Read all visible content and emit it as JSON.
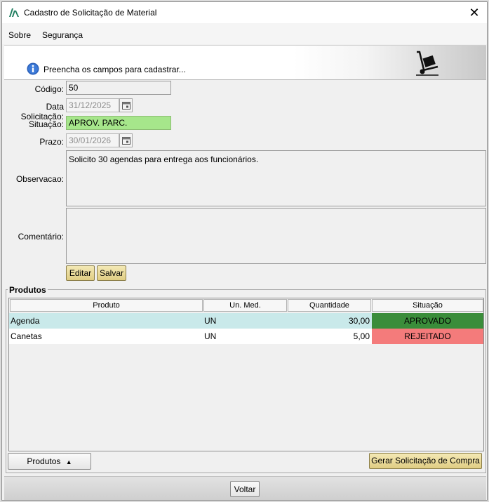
{
  "window": {
    "title": "Cadastro de Solicitação de Material"
  },
  "menu": {
    "sobre": "Sobre",
    "seguranca": "Segurança"
  },
  "banner": {
    "text": "Preencha os campos para cadastrar..."
  },
  "form": {
    "codigo_label": "Código:",
    "codigo_value": "50",
    "data_label": "Data Solicitação:",
    "data_value": "31/12/2025",
    "situacao_label": "Situação:",
    "situacao_value": "APROV. PARC.",
    "prazo_label": "Prazo:",
    "prazo_value": "30/01/2026",
    "observacao_label": "Observacao:",
    "observacao_value": "Solicito 30 agendas para entrega aos funcionários.",
    "comentario_label": "Comentário:",
    "comentario_value": ""
  },
  "buttons": {
    "editar": "Editar",
    "salvar": "Salvar",
    "produtos": "Produtos",
    "gerar": "Gerar Solicitação de Compra",
    "voltar": "Voltar"
  },
  "produtos": {
    "group_title": "Produtos",
    "columns": [
      "Produto",
      "Un. Med.",
      "Quantidade",
      "Situação"
    ],
    "rows": [
      {
        "produto": "Agenda",
        "un": "UN",
        "qtd": "30,00",
        "situacao": "APROVADO"
      },
      {
        "produto": "Canetas",
        "un": "UN",
        "qtd": "5,00",
        "situacao": "REJEITADO"
      }
    ]
  },
  "colors": {
    "approved": "#3a8d3a",
    "rejected": "#f47b7b",
    "selected_row": "#c9e9ea",
    "situacao_field": "#a6e68b"
  }
}
